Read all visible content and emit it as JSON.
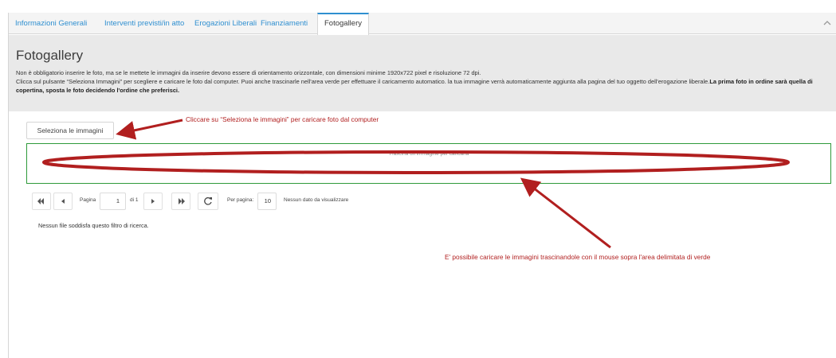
{
  "tabs": [
    {
      "label": "Informazioni Generali"
    },
    {
      "label": "Interventi previsti/in atto"
    },
    {
      "label": "Erogazioni Liberali"
    },
    {
      "label": "Finanziamenti"
    },
    {
      "label": "Fotogallery"
    }
  ],
  "active_tab": "Fotogallery",
  "header": {
    "title": "Fotogallery",
    "line1": "Non è obbligatorio inserire le foto, ma se le mettete le immagini da inserire devono essere di orientamento orizzontale, con dimensioni minime 1920x722 pixel e risoluzione 72 dpi.",
    "line2": "Clicca sul pulsante “Seleziona Immagini” per scegliere e caricare le foto dal computer. Puoi anche trascinarle nell'area verde per effettuare il caricamento automatico. la tua immagine verrà automaticamente aggiunta alla pagina del tuo oggetto dell'erogazione liberale.",
    "bold": "La prima foto in ordine sarà quella di copertina, sposta le foto decidendo l'ordine che preferisci."
  },
  "upload": {
    "select_label": "Seleziona le immagini",
    "dropzone_text": "Trascina un'immagine per caricarla"
  },
  "pager": {
    "page_label": "Pagina",
    "page_value": "1",
    "of_label": "di 1",
    "per_page_label": "Per pagina:",
    "per_page_value": "10",
    "no_data": "Nessun dato da visualizzare"
  },
  "empty_message": "Nessun file soddisfa questo filtro di ricerca.",
  "annotations": {
    "top": "Cliccare su “Seleziona le immagini” per caricare foto dal computer",
    "bottom": "E' possibile caricare le immagini trascinandole con il mouse sopra l'area delimitata di verde"
  },
  "colors": {
    "link": "#2f8fd0",
    "dropzone_border": "#2e9a3a",
    "annotation": "#b11f1f"
  }
}
